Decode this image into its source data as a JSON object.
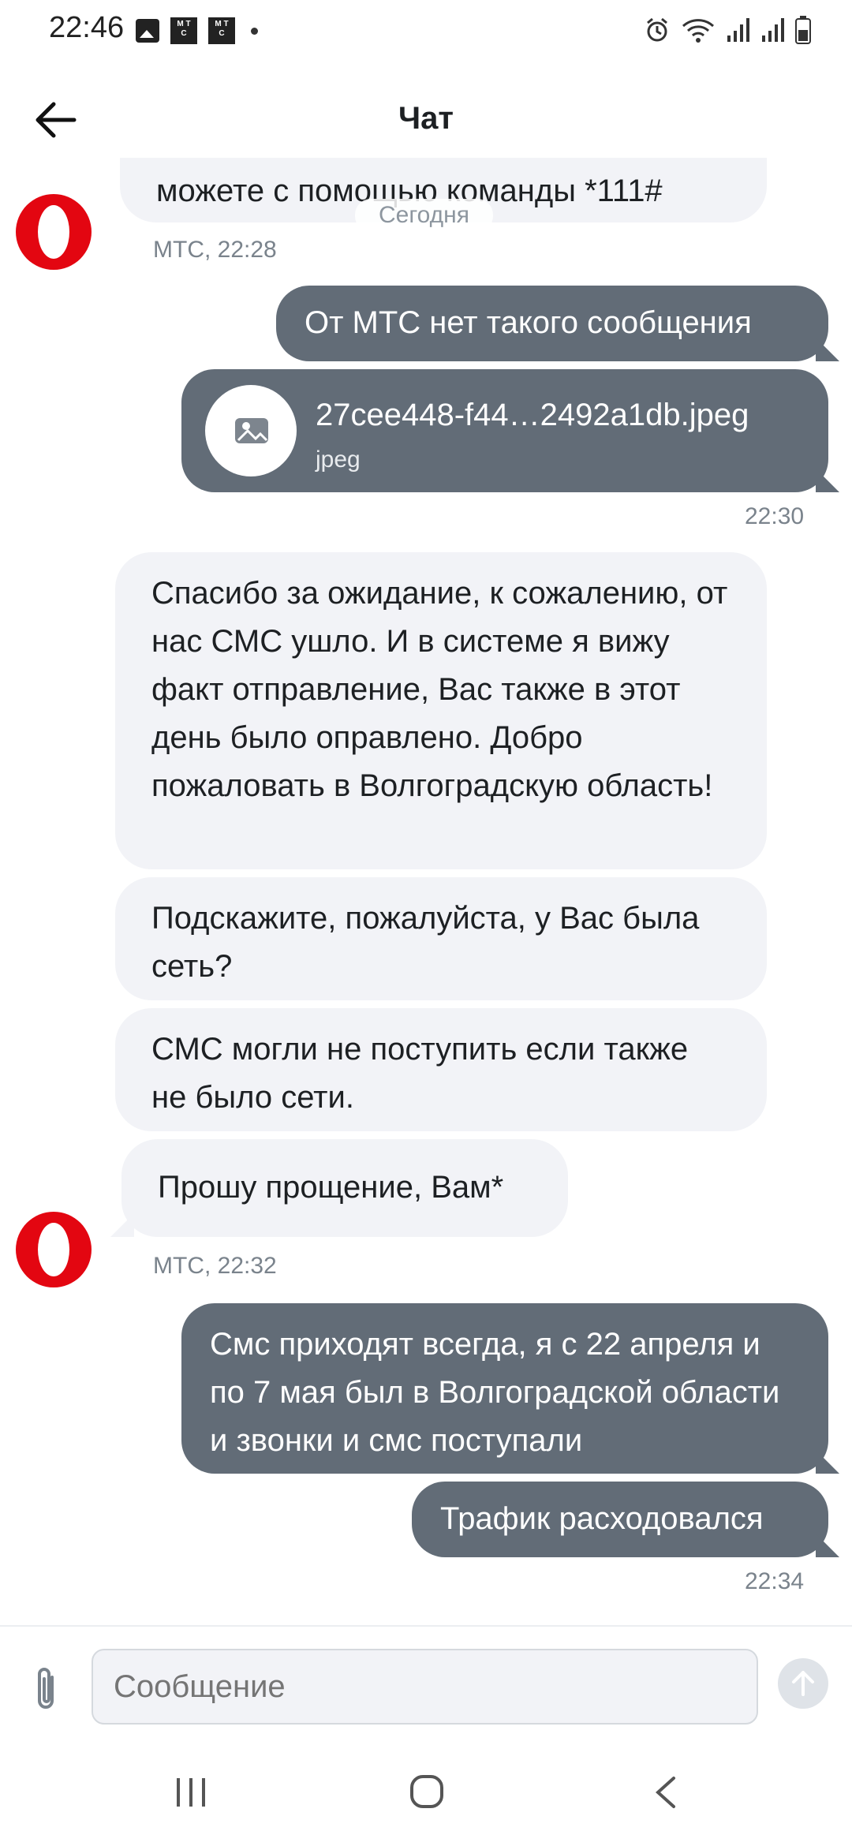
{
  "status": {
    "time": "22:46"
  },
  "header": {
    "title": "Чат"
  },
  "chat": {
    "top_partial_text": "можете с помощью команды *111#",
    "date_separator": "Сегодня",
    "meta1": "МТС, 22:28",
    "out_msg1": "От МТС нет такого сообщения",
    "file": {
      "name": "27cee448-f44…2492a1db.jpeg",
      "type": "jpeg"
    },
    "time1": "22:30",
    "in_msg1": "Спасибо за ожидание, к сожалению, от нас СМС ушло. И в системе я вижу факт отправление, Вас также в этот день было оправлено. Добро пожаловать в Волгоградскую область!",
    "in_msg2": "Подскажите, пожалуйста,  у Вас была сеть?",
    "in_msg3": "СМС могли не поступить если также не было сети.",
    "in_msg4": "Прошу прощение, Вам*",
    "meta2": "МТС, 22:32",
    "out_msg2": "Смс приходят всегда, я с 22 апреля и по 7 мая был в Волгоградской области и звонки и смс поступали",
    "out_msg3": "Трафик расходовался",
    "time2": "22:34"
  },
  "input": {
    "placeholder": "Сообщение"
  },
  "colors": {
    "accent": "#e30611",
    "bubble_out": "#626c77",
    "bubble_in": "#f2f3f7"
  },
  "icons": [
    "back-arrow-icon",
    "attach-clip-icon",
    "send-arrow-icon",
    "image-file-icon"
  ]
}
